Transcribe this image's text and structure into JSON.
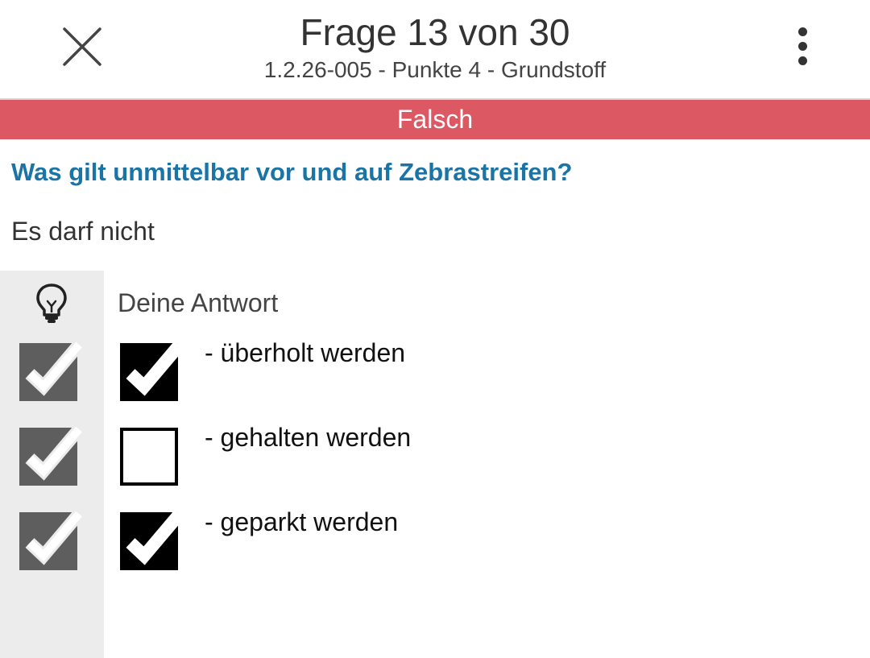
{
  "header": {
    "title": "Frage 13 von 30",
    "subtitle": "1.2.26-005 - Punkte 4 - Grundstoff",
    "close_icon": "close-icon",
    "menu_icon": "more-vertical-icon"
  },
  "result": {
    "label": "Falsch",
    "color": "#dc5964"
  },
  "question": {
    "text": "Was gilt unmittelbar vor und auf Zebrastreifen?",
    "intro": "Es darf nicht",
    "color": "#1a74a6"
  },
  "answers": {
    "hint_icon": "lightbulb-icon",
    "column_label": "Deine Antwort",
    "options": [
      {
        "label": "- überholt werden",
        "correct": true,
        "selected": true
      },
      {
        "label": "- gehalten werden",
        "correct": true,
        "selected": false
      },
      {
        "label": "- geparkt werden",
        "correct": true,
        "selected": true
      }
    ]
  }
}
